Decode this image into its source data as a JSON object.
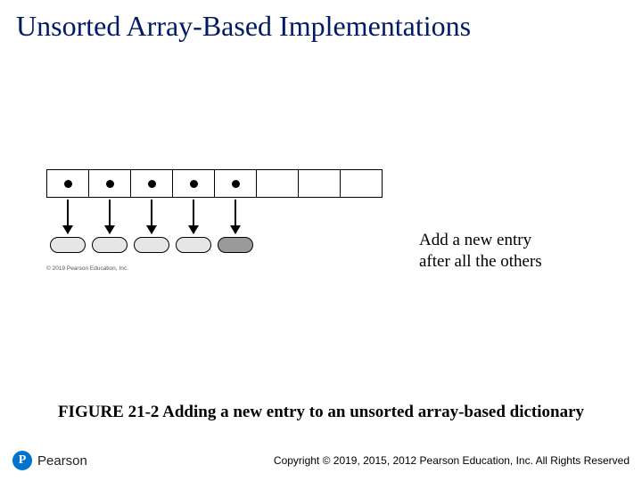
{
  "title": "Unsorted Array-Based Implementations",
  "figure": {
    "annotation_line1": "Add a new entry",
    "annotation_line2": "after all the others",
    "small_credit": "© 2019 Pearson Education, Inc."
  },
  "caption": "FIGURE 21-2 Adding a new entry to an unsorted array-based dictionary",
  "footer": {
    "logo_mark": "P",
    "brand": "Pearson",
    "copyright": "Copyright © 2019, 2015, 2012 Pearson Education, Inc. All Rights Reserved"
  }
}
